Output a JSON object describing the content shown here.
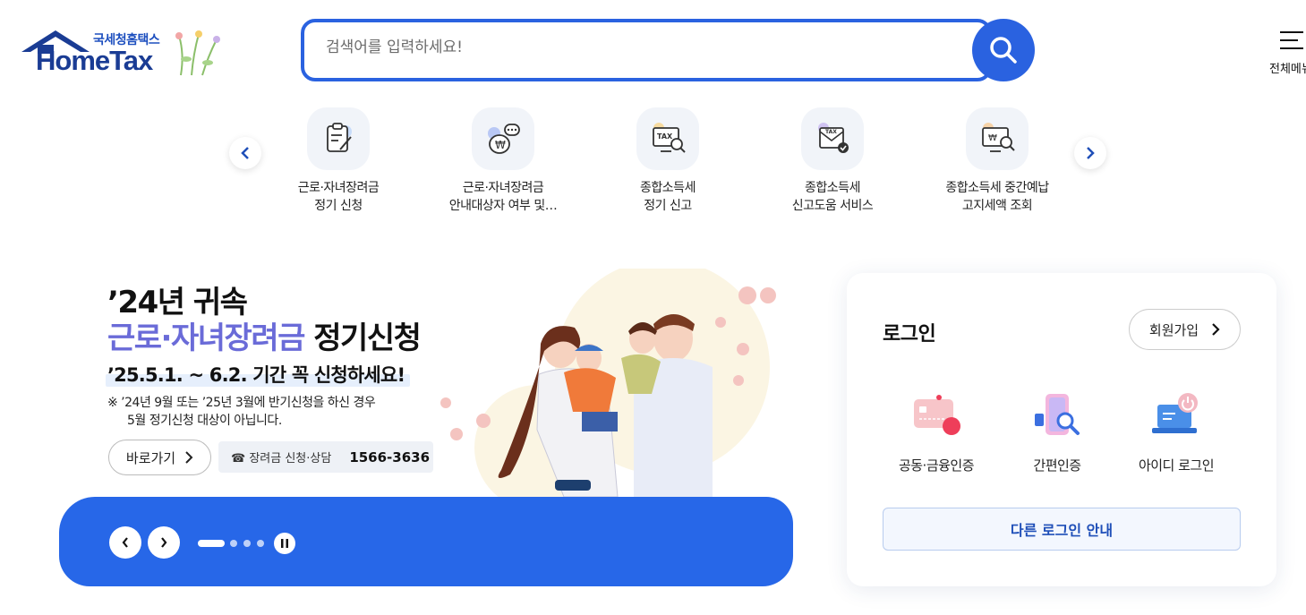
{
  "header": {
    "logo_small": "국세청홈택스",
    "logo_main": "HomeTax",
    "search_placeholder": "검색어를 입력하세요!",
    "menu_label": "전체메뉴"
  },
  "quick_menu": {
    "items": [
      {
        "label": "근로·자녀장려금\n정기 신청",
        "icon": "application-form-icon"
      },
      {
        "label": "근로·자녀장려금\n안내대상자 여부 및…",
        "icon": "money-bag-chat-icon"
      },
      {
        "label": "종합소득세\n정기 신고",
        "icon": "tax-monitor-search-icon"
      },
      {
        "label": "종합소득세\n신고도움 서비스",
        "icon": "tax-envelope-check-icon"
      },
      {
        "label": "종합소득세 중간예납\n고지세액 조회",
        "icon": "won-monitor-search-icon"
      }
    ]
  },
  "banner": {
    "line1": "’24년 귀속",
    "line2_highlight": "근로·자녀장려금",
    "line2_rest": " 정기신청",
    "period": "’25.5.1. ~ 6.2. 기간 꼭 신청하세요!",
    "note_line1": "※ ’24년 9월 또는 ’25년 3월에 반기신청을 하신 경우",
    "note_line2": "5월 정기신청 대상이 아닙니다.",
    "go_button": "바로가기",
    "call_label": "☎ 장려금 신청·상담",
    "call_number": "1566-3636"
  },
  "login": {
    "title": "로그인",
    "signup": "회원가입",
    "options": [
      {
        "label": "공동·금융인증"
      },
      {
        "label": "간편인증"
      },
      {
        "label": "아이디 로그인"
      }
    ],
    "other": "다른 로그인 안내"
  },
  "colors": {
    "brand_blue": "#2a62e0",
    "banner_bar": "#2767e8",
    "highlight_purple": "#6a6bd8"
  }
}
